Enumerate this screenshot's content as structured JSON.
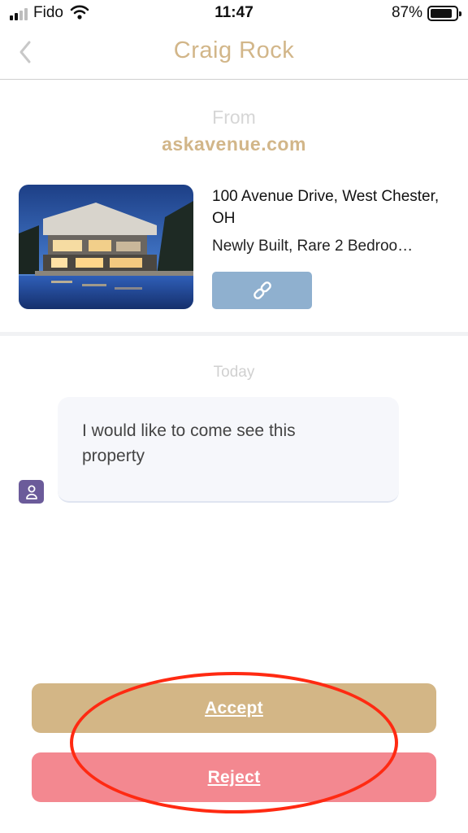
{
  "status_bar": {
    "carrier": "Fido",
    "time": "11:47",
    "battery_percent": "87%",
    "battery_level": 0.87
  },
  "nav": {
    "title": "Craig Rock",
    "back_icon": "chevron-left-icon"
  },
  "source": {
    "from_label": "From",
    "site": "askavenue.com"
  },
  "property": {
    "address": "100 Avenue Drive,  West Chester, OH",
    "description": "Newly Built, Rare 2 Bedroo…",
    "link_icon": "link-icon"
  },
  "chat": {
    "date_label": "Today",
    "messages": [
      {
        "text": "I would like to come see this property",
        "avatar_icon": "user-icon"
      }
    ]
  },
  "actions": {
    "accept_label": "Accept",
    "reject_label": "Reject"
  },
  "colors": {
    "accent_gold": "#d2b689",
    "accept": "#d3b686",
    "reject": "#f38890",
    "link_button": "#8fb0cf",
    "avatar": "#6b5b9a",
    "highlight": "#ff2a12"
  }
}
